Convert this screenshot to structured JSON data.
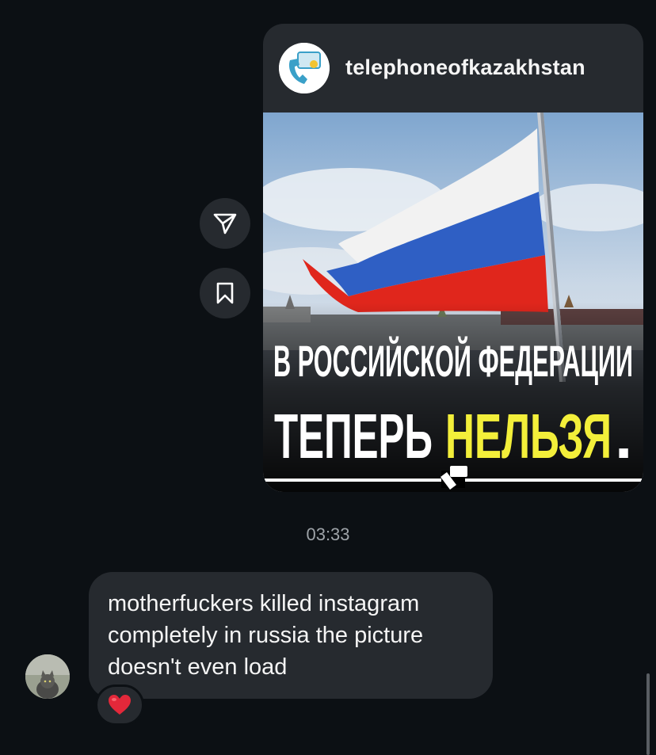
{
  "post": {
    "username": "telephoneofkazakhstan",
    "image_text": {
      "line1": "В РОССИЙСКОЙ ФЕДЕРАЦИИ",
      "line2_white": "ТЕПЕРЬ",
      "line2_yellow": "НЕЛЬЗЯ",
      "line2_dot": "."
    }
  },
  "timestamp": "03:33",
  "message": {
    "lines": [
      "motherfuckers killed instagram",
      "completely in russia the picture",
      "doesn't even load"
    ],
    "reaction": "❤️"
  },
  "icons": {
    "share": "paper-plane-icon",
    "save": "bookmark-icon",
    "heart": "heart-icon"
  },
  "colors": {
    "background": "#0c1014",
    "bubble": "#262a2f",
    "yellow_text": "#f3ef3a",
    "flag_white": "#f2f2f2",
    "flag_blue": "#2f5fc4",
    "flag_red": "#e0261c"
  }
}
